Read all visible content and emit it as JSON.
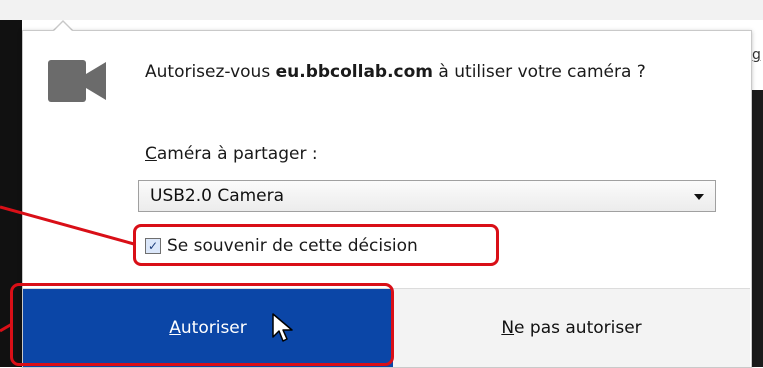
{
  "dialog": {
    "icon": "video-camera-icon",
    "message_prefix": "Autorisez-vous ",
    "message_domain": "eu.bbcollab.com",
    "message_suffix": " à utiliser votre caméra ?",
    "share_label_accesskey": "C",
    "share_label_rest": "améra à partager :",
    "camera_select": {
      "selected": "USB2.0 Camera"
    },
    "remember": {
      "label": "Se souvenir de cette décision",
      "checked": true
    },
    "buttons": {
      "allow_accesskey": "A",
      "allow_rest": "utoriser",
      "deny_accesskey": "N",
      "deny_rest": "e pas autoriser"
    }
  },
  "background": {
    "right_edge_glyph": "g"
  },
  "colors": {
    "allow_button": "#0b46a7",
    "highlight": "#d90f17",
    "icon_gray": "#6b6b6b"
  }
}
